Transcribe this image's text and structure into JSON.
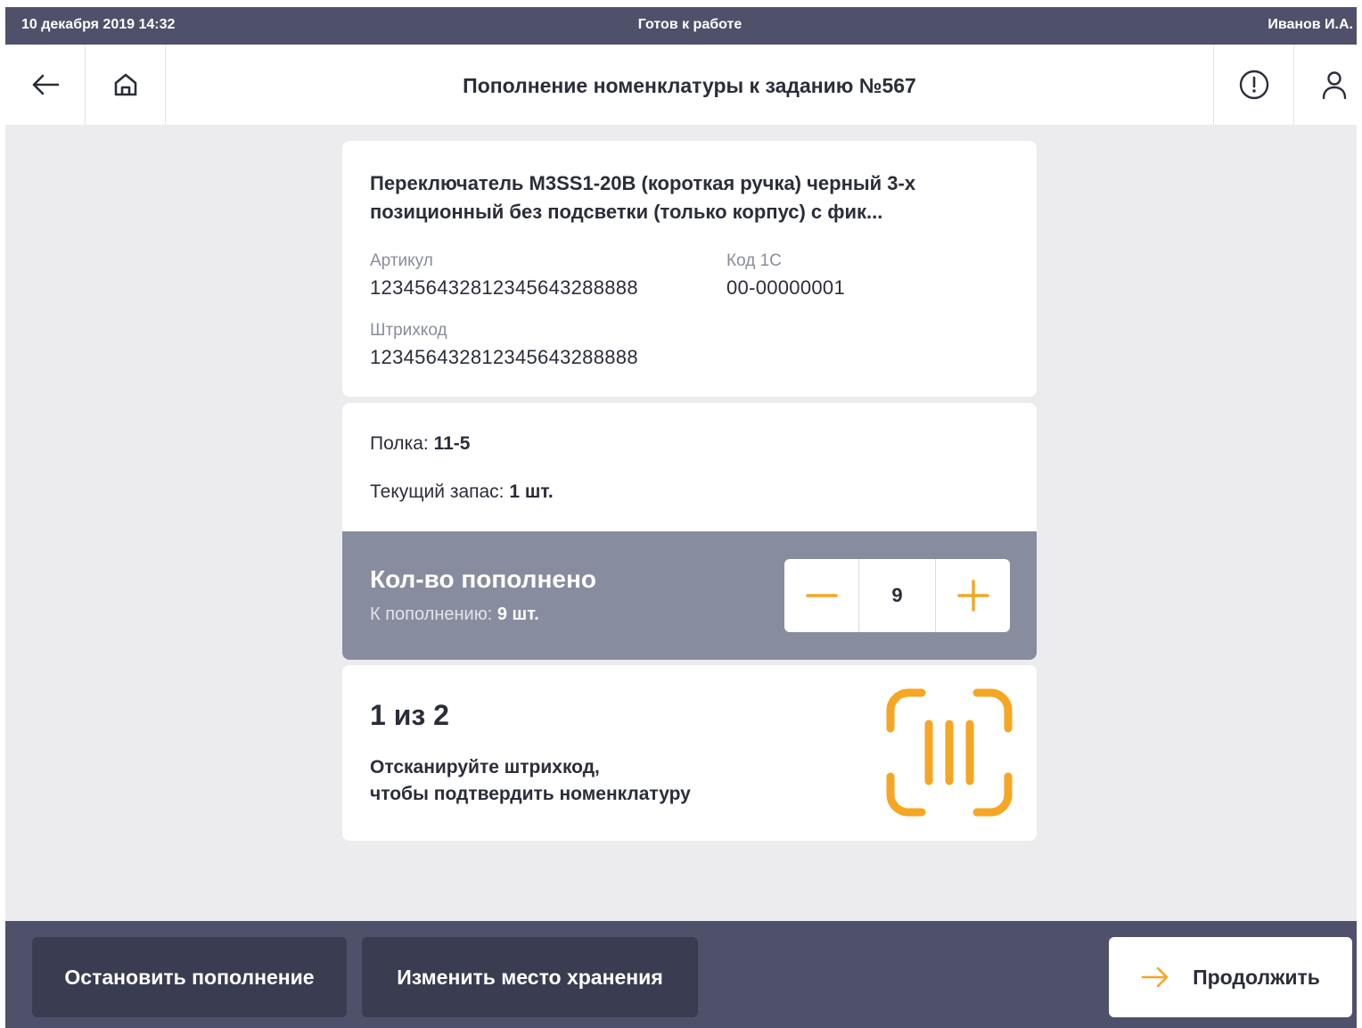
{
  "status_bar": {
    "datetime": "10 декабря 2019 14:32",
    "status": "Готов к работе",
    "user": "Иванов И.А."
  },
  "header": {
    "title": "Пополнение номенклатуры к заданию №567",
    "icons": [
      "arrow-left-icon",
      "home-icon",
      "alert-circle-icon",
      "user-icon"
    ]
  },
  "product": {
    "name": "Переключатель M3SS1-20B (короткая ручка) черный 3-х позиционный без подсветки (только корпус) с фик...",
    "article_label": "Артикул",
    "article_value": "123456432812345643288888",
    "code_label": "Код 1С",
    "code_value": "00-00000001",
    "barcode_label": "Штрихкод",
    "barcode_value": "123456432812345643288888"
  },
  "location": {
    "shelf_label": "Полка:",
    "shelf_value": "11-5",
    "stock_label": "Текущий запас:",
    "stock_value": "1 шт."
  },
  "quantity": {
    "title": "Кол-во пополнено",
    "to_fill_label": "К пополнению:",
    "to_fill_value": "9 шт.",
    "value": "9"
  },
  "scan": {
    "progress": "1 из 2",
    "instruction_line1": "Отсканируйте штрихкод,",
    "instruction_line2": "чтобы подтвердить номенклатуру"
  },
  "footer": {
    "stop_label": "Остановить пополнение",
    "change_label": "Изменить место хранения",
    "continue_label": "Продолжить"
  },
  "colors": {
    "accent": "#F5A623",
    "bar": "#4E5169",
    "panel": "#888C9F"
  }
}
